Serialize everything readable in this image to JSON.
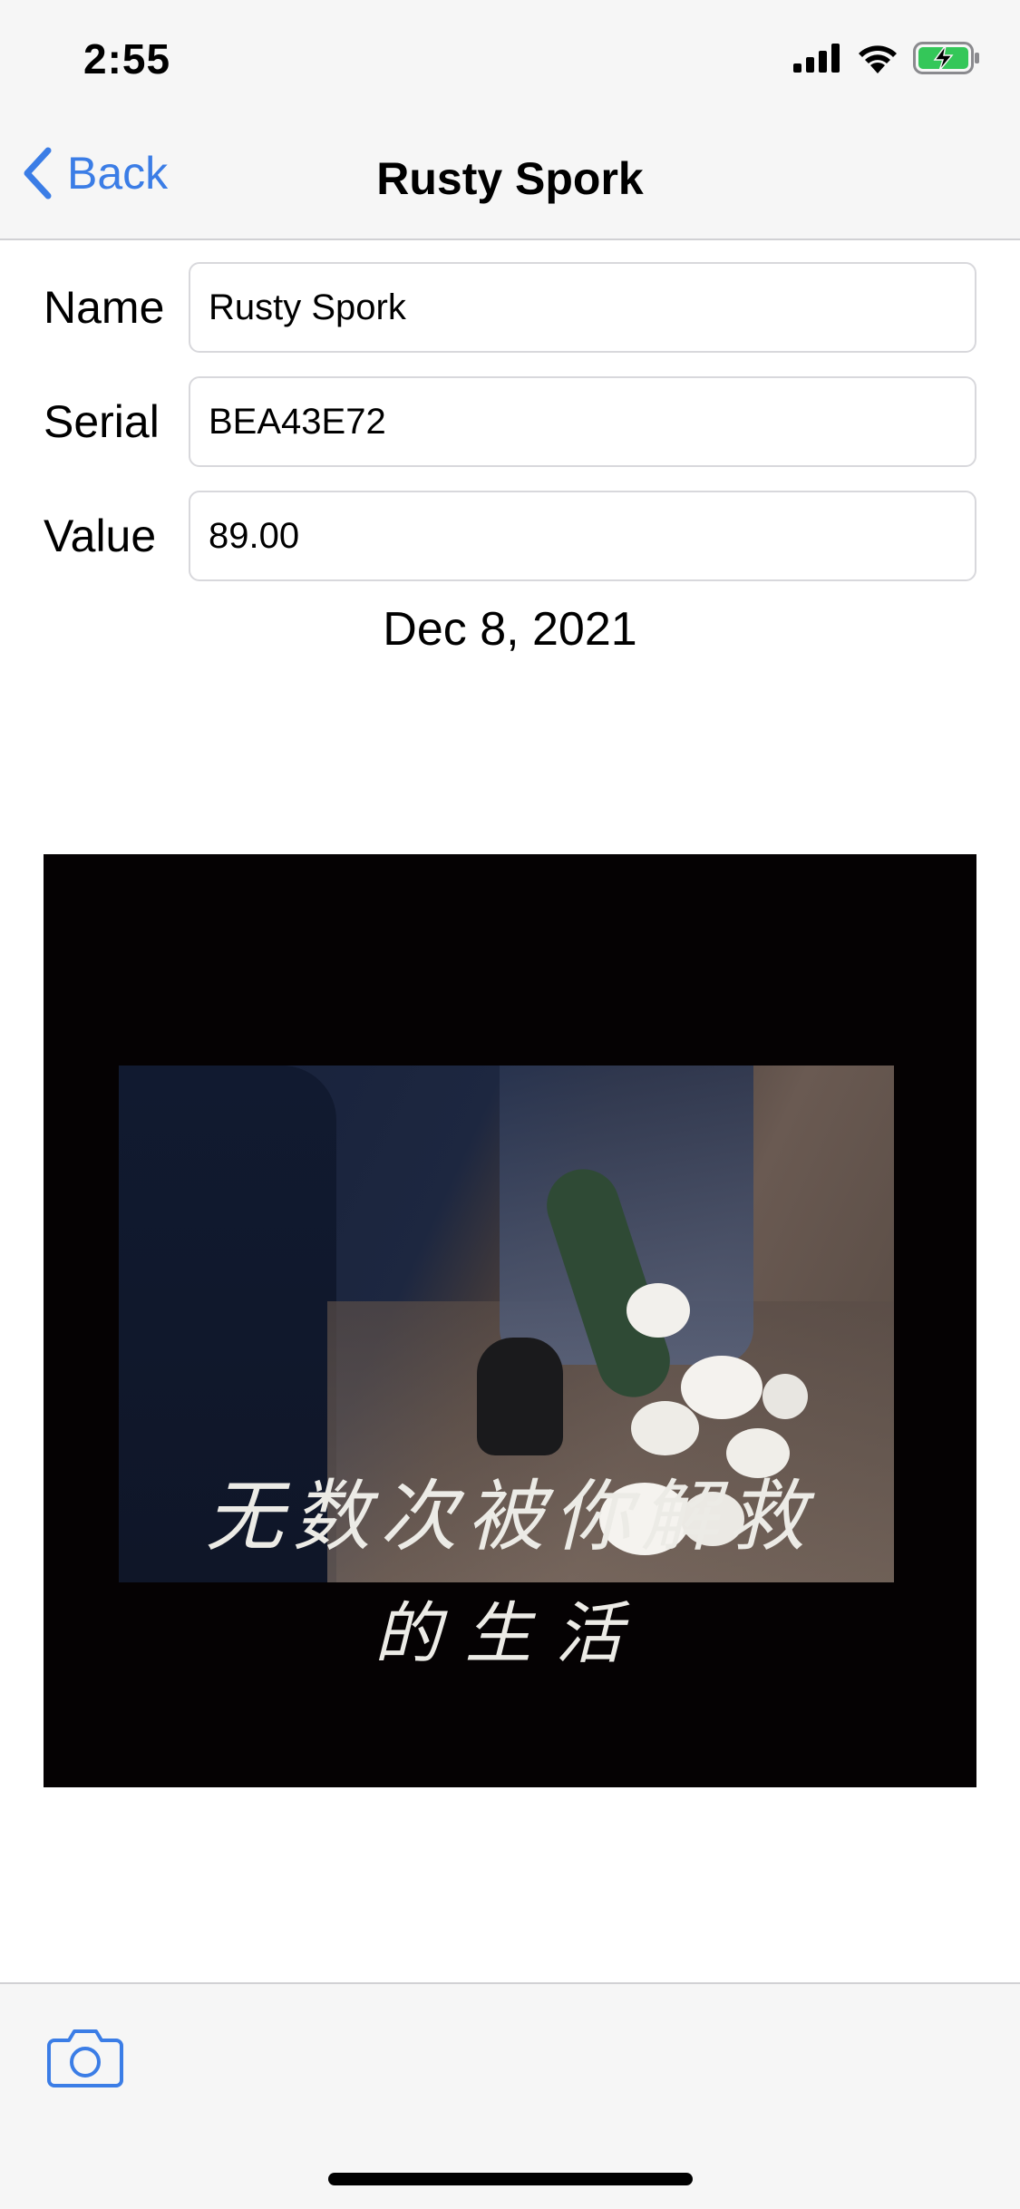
{
  "status_bar": {
    "time": "2:55",
    "icons": [
      "cellular-signal-icon",
      "wifi-icon",
      "battery-charging-icon"
    ]
  },
  "nav": {
    "back_label": "Back",
    "title": "Rusty Spork",
    "accent_color": "#3b7de6"
  },
  "form": {
    "name_label": "Name",
    "name_value": "Rusty Spork",
    "serial_label": "Serial",
    "serial_value": "BEA43E72",
    "value_label": "Value",
    "value_value": "89.00"
  },
  "date_created": "Dec 8, 2021",
  "photo": {
    "calligraphy_line1": "无数次被你解救",
    "calligraphy_line2": "的生活"
  },
  "toolbar": {
    "camera_icon": "camera-icon"
  }
}
